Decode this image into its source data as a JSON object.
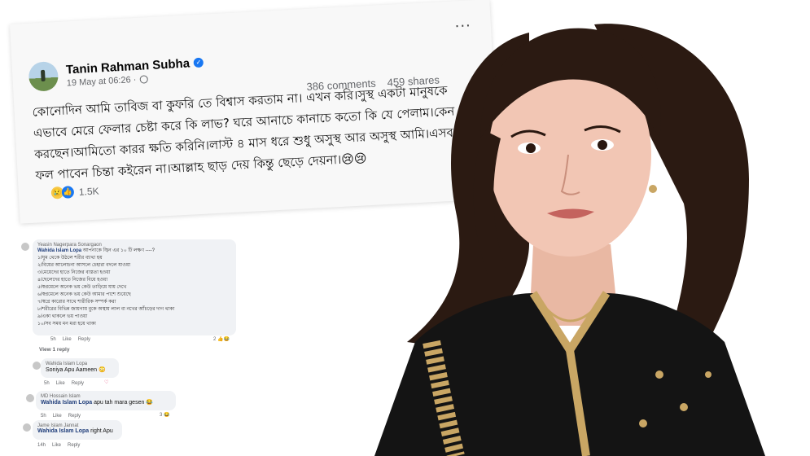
{
  "post": {
    "author": "Tanin Rahman Subha",
    "verified_icon": "✓",
    "timestamp": "19 May at 06:26 ·",
    "more": "...",
    "text": "কোনোদিন আমি তাবিজ বা কুফরি তে বিশ্বাস করতাম না। এখন করি।সুস্থ একটা মানুষকে এভাবে মেরে ফেলার চেষ্টা করে কি লাভ? ঘরে আনাচে কানাচে কতো কি যে পেলাম।কেন এমন করছেন।আমিতো কারর ক্ষতি করিনি।লাস্ট ৪ মাস ধরে শুধু অসুস্থ আর অসুস্থ আমি।এসব এর ফল পাবেন চিন্তা কইরেন না।আল্লাহ ছাড় দেয় কিন্তু ছেড়ে দেয়না।😢😢",
    "comments_count": "386 comments",
    "shares_count": "459 shares",
    "reactions_count": "1.5K",
    "reaction_icons": [
      "sad-icon",
      "like-icon"
    ]
  },
  "comments": {
    "main": {
      "author": "Yeasin Nagerpara Sonargaon",
      "tag": "Wahida Islam Lopa",
      "intro": "আপনাকে জ্বিন এর ১০ টি লক্ষণ ----?",
      "lines": [
        "১/ঘুম থেকে উঠলে শরীর ব্যাথা হয়",
        "২/বিয়ের আলোচনা আসলে চেহারা বদলে যাওয়া",
        "৩/মেয়েদের হাতে নিজের ব্যস্ততা হওয়া",
        "৪/ছেলেদের হাতে নিজের বিয়ে হওয়া",
        "৫/স্বপ্নমেলে অনেক ভয় কেউ তাড়িয়ে যায় দেখে",
        "৬/স্বপ্নমেলে অনেক ভয় কেউ আমার পাশে শুয়েছে",
        "৭/স্বপ্নে কারোর সাথে শারীরিক সম্পর্ক করা",
        "৮/শরীরের বিভিন্ন জায়গায় বুকে অস্থায় লাল বা নখের আঁচড়ের দাগ থাকা",
        "৯/একা থাকলে ভয় পাওয়া",
        "১০/সব সময় মন মরা হয়ে থাকা"
      ],
      "time": "5h",
      "like": "Like",
      "reply": "Reply",
      "reacts": "2",
      "view_replies": "View 1 reply"
    },
    "replies": [
      {
        "author": "Wahida Islam Lopa",
        "text": "Soniya Apu Aameen 😳",
        "time": "5h",
        "like": "Like",
        "reply": "Reply",
        "reacts": ""
      },
      {
        "author": "MD Hossain Islam",
        "tag": "Wahida Islam Lopa",
        "text": "apu tah mara gesen 😂",
        "time": "5h",
        "like": "Like",
        "reply": "Reply",
        "reacts": "3"
      },
      {
        "author": "Jame Islam Jannat",
        "tag": "Wahida Islam Lopa",
        "text": "right Apu",
        "time": "14h",
        "like": "Like",
        "reply": "Reply",
        "reacts": ""
      }
    ]
  },
  "colors": {
    "facebook_blue": "#1877f2",
    "dress": "#141414",
    "embroidery_gold": "#c9a664",
    "hair": "#2b1a12"
  }
}
